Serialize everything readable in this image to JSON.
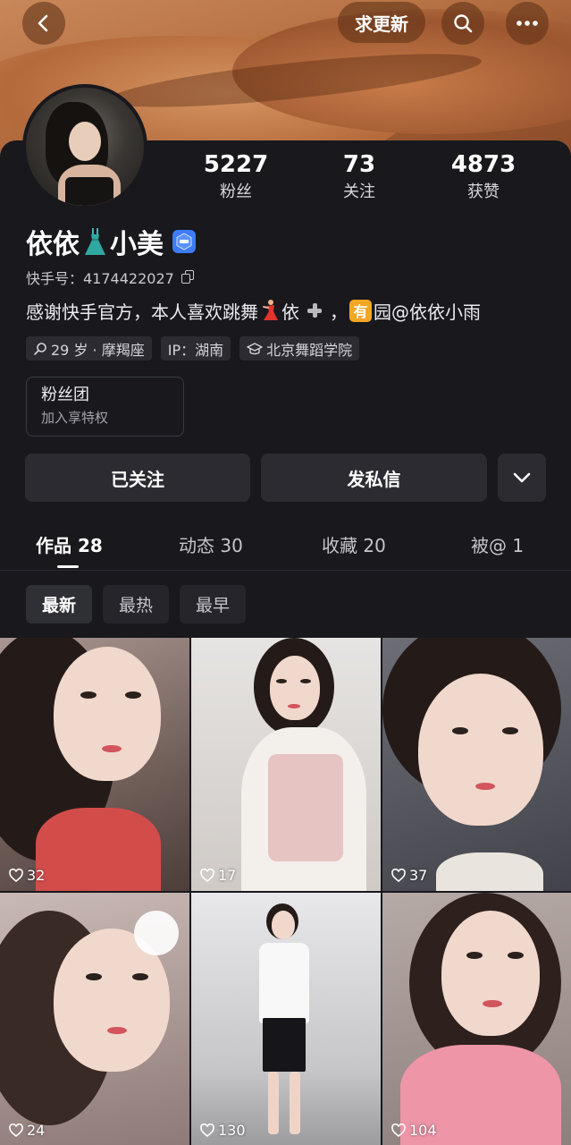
{
  "header": {
    "update_button": "求更新"
  },
  "stats": [
    {
      "value": "5227",
      "label": "粉丝"
    },
    {
      "value": "73",
      "label": "关注"
    },
    {
      "value": "4873",
      "label": "获赞"
    }
  ],
  "profile": {
    "name_part1": "依依",
    "name_part2": "小美",
    "kuaishou_id": "快手号：4174422027",
    "bio_part1": "感谢快手官方，本人喜欢跳舞",
    "bio_part2": "依",
    "bio_part3": "，",
    "bio_tag": "有",
    "bio_part4": "园@依依小雨"
  },
  "tags": [
    {
      "icon": "search-icon",
      "text": "29 岁 · 摩羯座"
    },
    {
      "icon": null,
      "text": "IP：湖南"
    },
    {
      "icon": "graduation-cap-icon",
      "text": "北京舞蹈学院"
    }
  ],
  "fans_group": {
    "title": "粉丝团",
    "subtitle": "加入享特权"
  },
  "actions": {
    "followed": "已关注",
    "message": "发私信"
  },
  "tabs": [
    {
      "label": "作品",
      "count": "28"
    },
    {
      "label": "动态",
      "count": "30"
    },
    {
      "label": "收藏",
      "count": "20"
    },
    {
      "label": "被@",
      "count": "1"
    }
  ],
  "sort_options": [
    "最新",
    "最热",
    "最早"
  ],
  "videos": [
    {
      "likes": "32"
    },
    {
      "likes": "17"
    },
    {
      "likes": "37"
    },
    {
      "likes": "24"
    },
    {
      "likes": "130"
    },
    {
      "likes": "104"
    }
  ],
  "colors": {
    "background": "#18181d",
    "button_bg": "#2b2b31",
    "verify_badge": "#3e7bf7",
    "tag_badge": "#f5a623"
  }
}
